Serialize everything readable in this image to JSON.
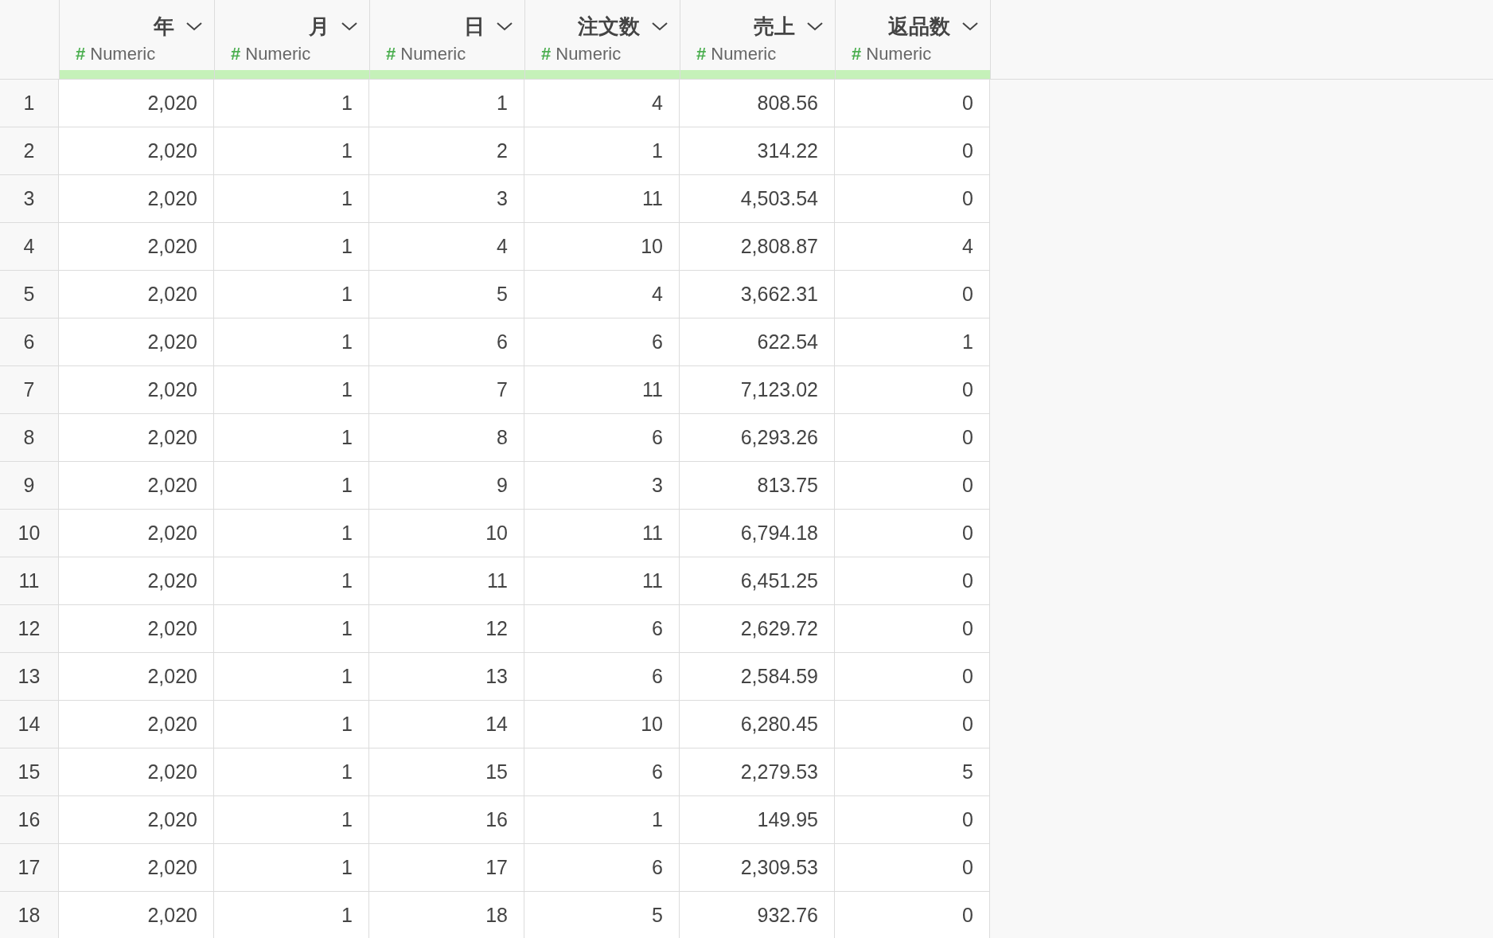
{
  "table": {
    "columns": [
      {
        "name": "年",
        "type_mark": "#",
        "type": "Numeric"
      },
      {
        "name": "月",
        "type_mark": "#",
        "type": "Numeric"
      },
      {
        "name": "日",
        "type_mark": "#",
        "type": "Numeric"
      },
      {
        "name": "注文数",
        "type_mark": "#",
        "type": "Numeric"
      },
      {
        "name": "売上",
        "type_mark": "#",
        "type": "Numeric"
      },
      {
        "name": "返品数",
        "type_mark": "#",
        "type": "Numeric"
      }
    ],
    "rows": [
      {
        "index": "1",
        "cells": [
          "2,020",
          "1",
          "1",
          "4",
          "808.56",
          "0"
        ]
      },
      {
        "index": "2",
        "cells": [
          "2,020",
          "1",
          "2",
          "1",
          "314.22",
          "0"
        ]
      },
      {
        "index": "3",
        "cells": [
          "2,020",
          "1",
          "3",
          "11",
          "4,503.54",
          "0"
        ]
      },
      {
        "index": "4",
        "cells": [
          "2,020",
          "1",
          "4",
          "10",
          "2,808.87",
          "4"
        ]
      },
      {
        "index": "5",
        "cells": [
          "2,020",
          "1",
          "5",
          "4",
          "3,662.31",
          "0"
        ]
      },
      {
        "index": "6",
        "cells": [
          "2,020",
          "1",
          "6",
          "6",
          "622.54",
          "1"
        ]
      },
      {
        "index": "7",
        "cells": [
          "2,020",
          "1",
          "7",
          "11",
          "7,123.02",
          "0"
        ]
      },
      {
        "index": "8",
        "cells": [
          "2,020",
          "1",
          "8",
          "6",
          "6,293.26",
          "0"
        ]
      },
      {
        "index": "9",
        "cells": [
          "2,020",
          "1",
          "9",
          "3",
          "813.75",
          "0"
        ]
      },
      {
        "index": "10",
        "cells": [
          "2,020",
          "1",
          "10",
          "11",
          "6,794.18",
          "0"
        ]
      },
      {
        "index": "11",
        "cells": [
          "2,020",
          "1",
          "11",
          "11",
          "6,451.25",
          "0"
        ]
      },
      {
        "index": "12",
        "cells": [
          "2,020",
          "1",
          "12",
          "6",
          "2,629.72",
          "0"
        ]
      },
      {
        "index": "13",
        "cells": [
          "2,020",
          "1",
          "13",
          "6",
          "2,584.59",
          "0"
        ]
      },
      {
        "index": "14",
        "cells": [
          "2,020",
          "1",
          "14",
          "10",
          "6,280.45",
          "0"
        ]
      },
      {
        "index": "15",
        "cells": [
          "2,020",
          "1",
          "15",
          "6",
          "2,279.53",
          "5"
        ]
      },
      {
        "index": "16",
        "cells": [
          "2,020",
          "1",
          "16",
          "1",
          "149.95",
          "0"
        ]
      },
      {
        "index": "17",
        "cells": [
          "2,020",
          "1",
          "17",
          "6",
          "2,309.53",
          "0"
        ]
      },
      {
        "index": "18",
        "cells": [
          "2,020",
          "1",
          "18",
          "5",
          "932.76",
          "0"
        ]
      }
    ]
  }
}
